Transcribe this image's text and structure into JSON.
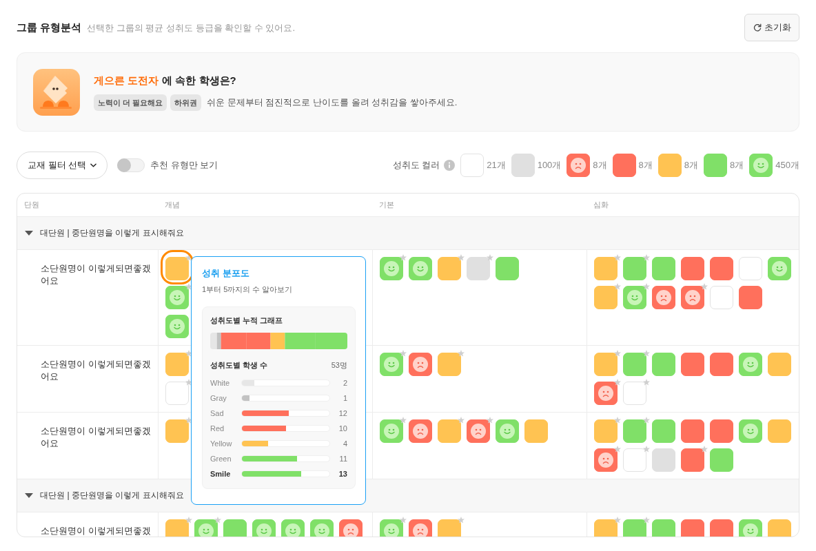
{
  "header": {
    "title": "그룹 유형분석",
    "subtitle": "선택한 그룹의 평균 성취도 등급을 확인할 수 있어요.",
    "reset_label": "초기화"
  },
  "type_card": {
    "type_name": "게으른 도전자",
    "question": "에 속한 학생은?",
    "tags": [
      "노력이 더 필요해요",
      "하위권"
    ],
    "description": "쉬운 문제부터 점진적으로 난이도를 올려 성취감을 쌓아주세요."
  },
  "filters": {
    "textbook_filter": "교재 필터 선택",
    "toggle": {
      "label": "추천 유형만 보기",
      "on": false
    }
  },
  "legend": {
    "label": "성취도 컬러",
    "items": [
      {
        "kind": "white",
        "count": "21개"
      },
      {
        "kind": "gray",
        "count": "100개"
      },
      {
        "kind": "sad",
        "count": "8개"
      },
      {
        "kind": "red",
        "count": "8개"
      },
      {
        "kind": "yellow",
        "count": "8개"
      },
      {
        "kind": "green",
        "count": "8개"
      },
      {
        "kind": "smile",
        "count": "450개"
      }
    ]
  },
  "table": {
    "columns": [
      "단원",
      "개념",
      "기본",
      "심화"
    ],
    "groups": [
      {
        "title": "대단원 | 중단원명을 이렇게 표시해줘요",
        "expanded": true,
        "rows": [
          {
            "unit": "소단원명이 이렇게되면좋겠어요",
            "cells": [
              {
                "lines": [
                  [
                    {
                      "kind": "yellow",
                      "starred": true,
                      "selected": true
                    }
                  ],
                  [
                    {
                      "kind": "smile",
                      "starred": true,
                      "selected": false
                    }
                  ],
                  [
                    {
                      "kind": "smile",
                      "starred": false,
                      "selected": false
                    }
                  ]
                ]
              },
              {
                "lines": [
                  [
                    {
                      "kind": "smile",
                      "starred": true,
                      "selected": false
                    },
                    {
                      "kind": "smile",
                      "starred": false,
                      "selected": false
                    },
                    {
                      "kind": "yellow",
                      "starred": true,
                      "selected": false
                    },
                    {
                      "kind": "gray",
                      "starred": true,
                      "selected": false
                    },
                    {
                      "kind": "green",
                      "starred": false,
                      "selected": false
                    }
                  ]
                ]
              },
              {
                "lines": [
                  [
                    {
                      "kind": "yellow",
                      "starred": true,
                      "selected": false
                    },
                    {
                      "kind": "green",
                      "starred": true,
                      "selected": false
                    },
                    {
                      "kind": "green",
                      "starred": false,
                      "selected": false
                    },
                    {
                      "kind": "red",
                      "starred": false,
                      "selected": false
                    },
                    {
                      "kind": "red",
                      "starred": false,
                      "selected": false
                    },
                    {
                      "kind": "white",
                      "starred": false,
                      "selected": false
                    },
                    {
                      "kind": "smile",
                      "starred": false,
                      "selected": false
                    }
                  ],
                  [
                    {
                      "kind": "yellow",
                      "starred": true,
                      "selected": false
                    },
                    {
                      "kind": "smile",
                      "starred": true,
                      "selected": false
                    },
                    {
                      "kind": "sad",
                      "starred": false,
                      "selected": false
                    },
                    {
                      "kind": "sad",
                      "starred": true,
                      "selected": false
                    },
                    {
                      "kind": "white",
                      "starred": false,
                      "selected": false
                    },
                    {
                      "kind": "red",
                      "starred": false,
                      "selected": false
                    }
                  ]
                ]
              }
            ]
          },
          {
            "unit": "소단원명이 이렇게되면좋겠어요",
            "cells": [
              {
                "lines": [
                  [
                    {
                      "kind": "yellow",
                      "starred": true,
                      "selected": false
                    }
                  ],
                  [
                    {
                      "kind": "white",
                      "starred": true,
                      "selected": false
                    }
                  ]
                ]
              },
              {
                "lines": [
                  [
                    {
                      "kind": "smile",
                      "starred": true,
                      "selected": false
                    },
                    {
                      "kind": "sad",
                      "starred": false,
                      "selected": false
                    },
                    {
                      "kind": "yellow",
                      "starred": true,
                      "selected": false
                    }
                  ]
                ]
              },
              {
                "lines": [
                  [
                    {
                      "kind": "yellow",
                      "starred": true,
                      "selected": false
                    },
                    {
                      "kind": "green",
                      "starred": true,
                      "selected": false
                    },
                    {
                      "kind": "green",
                      "starred": false,
                      "selected": false
                    },
                    {
                      "kind": "red",
                      "starred": false,
                      "selected": false
                    },
                    {
                      "kind": "red",
                      "starred": false,
                      "selected": false
                    },
                    {
                      "kind": "smile",
                      "starred": false,
                      "selected": false
                    },
                    {
                      "kind": "yellow",
                      "starred": false,
                      "selected": false
                    }
                  ],
                  [
                    {
                      "kind": "sad",
                      "starred": true,
                      "selected": false
                    },
                    {
                      "kind": "white",
                      "starred": true,
                      "selected": false
                    }
                  ]
                ]
              }
            ]
          },
          {
            "unit": "소단원명이 이렇게되면좋겠어요",
            "cells": [
              {
                "lines": [
                  [
                    {
                      "kind": "yellow",
                      "starred": true,
                      "selected": false
                    }
                  ]
                ]
              },
              {
                "lines": [
                  [
                    {
                      "kind": "smile",
                      "starred": true,
                      "selected": false
                    },
                    {
                      "kind": "sad",
                      "starred": false,
                      "selected": false
                    },
                    {
                      "kind": "yellow",
                      "starred": true,
                      "selected": false
                    },
                    {
                      "kind": "sad",
                      "starred": true,
                      "selected": false
                    },
                    {
                      "kind": "smile",
                      "starred": false,
                      "selected": false
                    },
                    {
                      "kind": "yellow",
                      "starred": false,
                      "selected": false
                    }
                  ]
                ]
              },
              {
                "lines": [
                  [
                    {
                      "kind": "yellow",
                      "starred": true,
                      "selected": false
                    },
                    {
                      "kind": "green",
                      "starred": true,
                      "selected": false
                    },
                    {
                      "kind": "green",
                      "starred": false,
                      "selected": false
                    },
                    {
                      "kind": "red",
                      "starred": false,
                      "selected": false
                    },
                    {
                      "kind": "red",
                      "starred": false,
                      "selected": false
                    },
                    {
                      "kind": "smile",
                      "starred": false,
                      "selected": false
                    },
                    {
                      "kind": "yellow",
                      "starred": false,
                      "selected": false
                    }
                  ],
                  [
                    {
                      "kind": "sad",
                      "starred": true,
                      "selected": false
                    },
                    {
                      "kind": "white",
                      "starred": true,
                      "selected": false
                    },
                    {
                      "kind": "gray",
                      "starred": false,
                      "selected": false
                    },
                    {
                      "kind": "red",
                      "starred": true,
                      "selected": false
                    },
                    {
                      "kind": "green",
                      "starred": false,
                      "selected": false
                    }
                  ]
                ]
              }
            ]
          }
        ]
      },
      {
        "title": "대단원 | 중단원명을 이렇게 표시해줘요",
        "expanded": true,
        "rows": [
          {
            "unit": "소단원명이 이렇게되면좋겠",
            "cells": [
              {
                "lines": [
                  [
                    {
                      "kind": "yellow",
                      "starred": true,
                      "selected": false
                    },
                    {
                      "kind": "smile",
                      "starred": true,
                      "selected": false
                    },
                    {
                      "kind": "green",
                      "starred": false,
                      "selected": false
                    },
                    {
                      "kind": "smile",
                      "starred": false,
                      "selected": false
                    },
                    {
                      "kind": "smile",
                      "starred": false,
                      "selected": false
                    },
                    {
                      "kind": "smile",
                      "starred": false,
                      "selected": false
                    },
                    {
                      "kind": "sad",
                      "starred": false,
                      "selected": false
                    }
                  ]
                ]
              },
              {
                "lines": [
                  [
                    {
                      "kind": "smile",
                      "starred": true,
                      "selected": false
                    },
                    {
                      "kind": "sad",
                      "starred": false,
                      "selected": false
                    },
                    {
                      "kind": "yellow",
                      "starred": true,
                      "selected": false
                    }
                  ]
                ]
              },
              {
                "lines": [
                  [
                    {
                      "kind": "yellow",
                      "starred": true,
                      "selected": false
                    },
                    {
                      "kind": "green",
                      "starred": true,
                      "selected": false
                    },
                    {
                      "kind": "green",
                      "starred": false,
                      "selected": false
                    },
                    {
                      "kind": "red",
                      "starred": false,
                      "selected": false
                    },
                    {
                      "kind": "red",
                      "starred": false,
                      "selected": false
                    },
                    {
                      "kind": "smile",
                      "starred": false,
                      "selected": false
                    },
                    {
                      "kind": "yellow",
                      "starred": false,
                      "selected": false
                    }
                  ]
                ]
              }
            ]
          }
        ]
      }
    ]
  },
  "popup": {
    "title": "성취 분포도",
    "subtitle": "1부터 5까지의 수 알아보기",
    "graph_title": "성취도별 누적 그래프",
    "count_title": "성취도별 학생 수",
    "total": "53명",
    "items": [
      {
        "label": "White",
        "color": "#e6e6e6",
        "level": 0.14,
        "count": "2",
        "highlighted": false
      },
      {
        "label": "Gray",
        "color": "#c2c2c2",
        "level": 0.085,
        "count": "1",
        "highlighted": false
      },
      {
        "label": "Sad",
        "color": "#ff705c",
        "level": 0.535,
        "count": "12",
        "highlighted": false
      },
      {
        "label": "Red",
        "color": "#ff705c",
        "level": 0.5,
        "count": "10",
        "highlighted": false
      },
      {
        "label": "Yellow",
        "color": "#ffc352",
        "level": 0.3,
        "count": "4",
        "highlighted": false
      },
      {
        "label": "Green",
        "color": "#80e068",
        "level": 0.63,
        "count": "11",
        "highlighted": false
      },
      {
        "label": "Smile",
        "color": "#80e068",
        "level": 0.675,
        "count": "13",
        "highlighted": true
      }
    ]
  }
}
